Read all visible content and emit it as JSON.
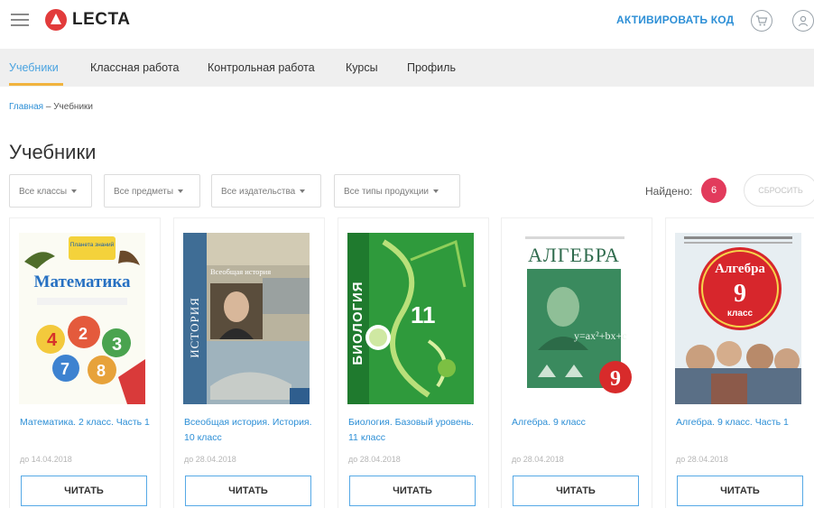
{
  "header": {
    "logo_text": "LECTA",
    "activate_label": "АКТИВИРОВАТЬ КОД"
  },
  "nav": {
    "tabs": [
      {
        "label": "Учебники",
        "active": true
      },
      {
        "label": "Классная работа",
        "active": false
      },
      {
        "label": "Контрольная работа",
        "active": false
      },
      {
        "label": "Курсы",
        "active": false
      },
      {
        "label": "Профиль",
        "active": false
      }
    ]
  },
  "breadcrumb": {
    "home": "Главная",
    "separator": " – ",
    "current": "Учебники"
  },
  "page_title": "Учебники",
  "filters": [
    {
      "label": "Все классы"
    },
    {
      "label": "Все предметы"
    },
    {
      "label": "Все издательства"
    },
    {
      "label": "Все типы продукции"
    }
  ],
  "found": {
    "label": "Найдено:",
    "count": "6"
  },
  "reset_label": "СБРОСИТЬ",
  "books": [
    {
      "title": "Математика. 2 класс. Часть 1",
      "date": "до 14.04.2018",
      "button": "ЧИТАТЬ",
      "cover": "math"
    },
    {
      "title": "Всеобщая история. История. 10 класс",
      "date": "до 28.04.2018",
      "button": "ЧИТАТЬ",
      "cover": "history"
    },
    {
      "title": "Биология. Базовый уровень. 11 класс",
      "date": "до 28.04.2018",
      "button": "ЧИТАТЬ",
      "cover": "biology"
    },
    {
      "title": "Алгебра. 9 класс",
      "date": "до 28.04.2018",
      "button": "ЧИТАТЬ",
      "cover": "algebra"
    },
    {
      "title": "Алгебра. 9 класс. Часть 1",
      "date": "до 28.04.2018",
      "button": "ЧИТАТЬ",
      "cover": "algebra2"
    }
  ],
  "cover_text": {
    "math_series": "Планета знаний",
    "math_title": "Математика",
    "history_subject": "ИСТОРИЯ",
    "history_title": "Всеобщая история",
    "biology_subject": "БИОЛОГИЯ",
    "biology_grade": "11",
    "algebra_title": "АЛГЕБРА",
    "algebra_grade": "9",
    "algebra2_title": "Алгебра",
    "algebra2_grade": "9",
    "algebra2_sub": "класс"
  },
  "colors": {
    "accent": "#2d8fd6",
    "badge": "#e23b5c",
    "logo": "#e23b3b",
    "active_underline": "#f1b33d"
  }
}
